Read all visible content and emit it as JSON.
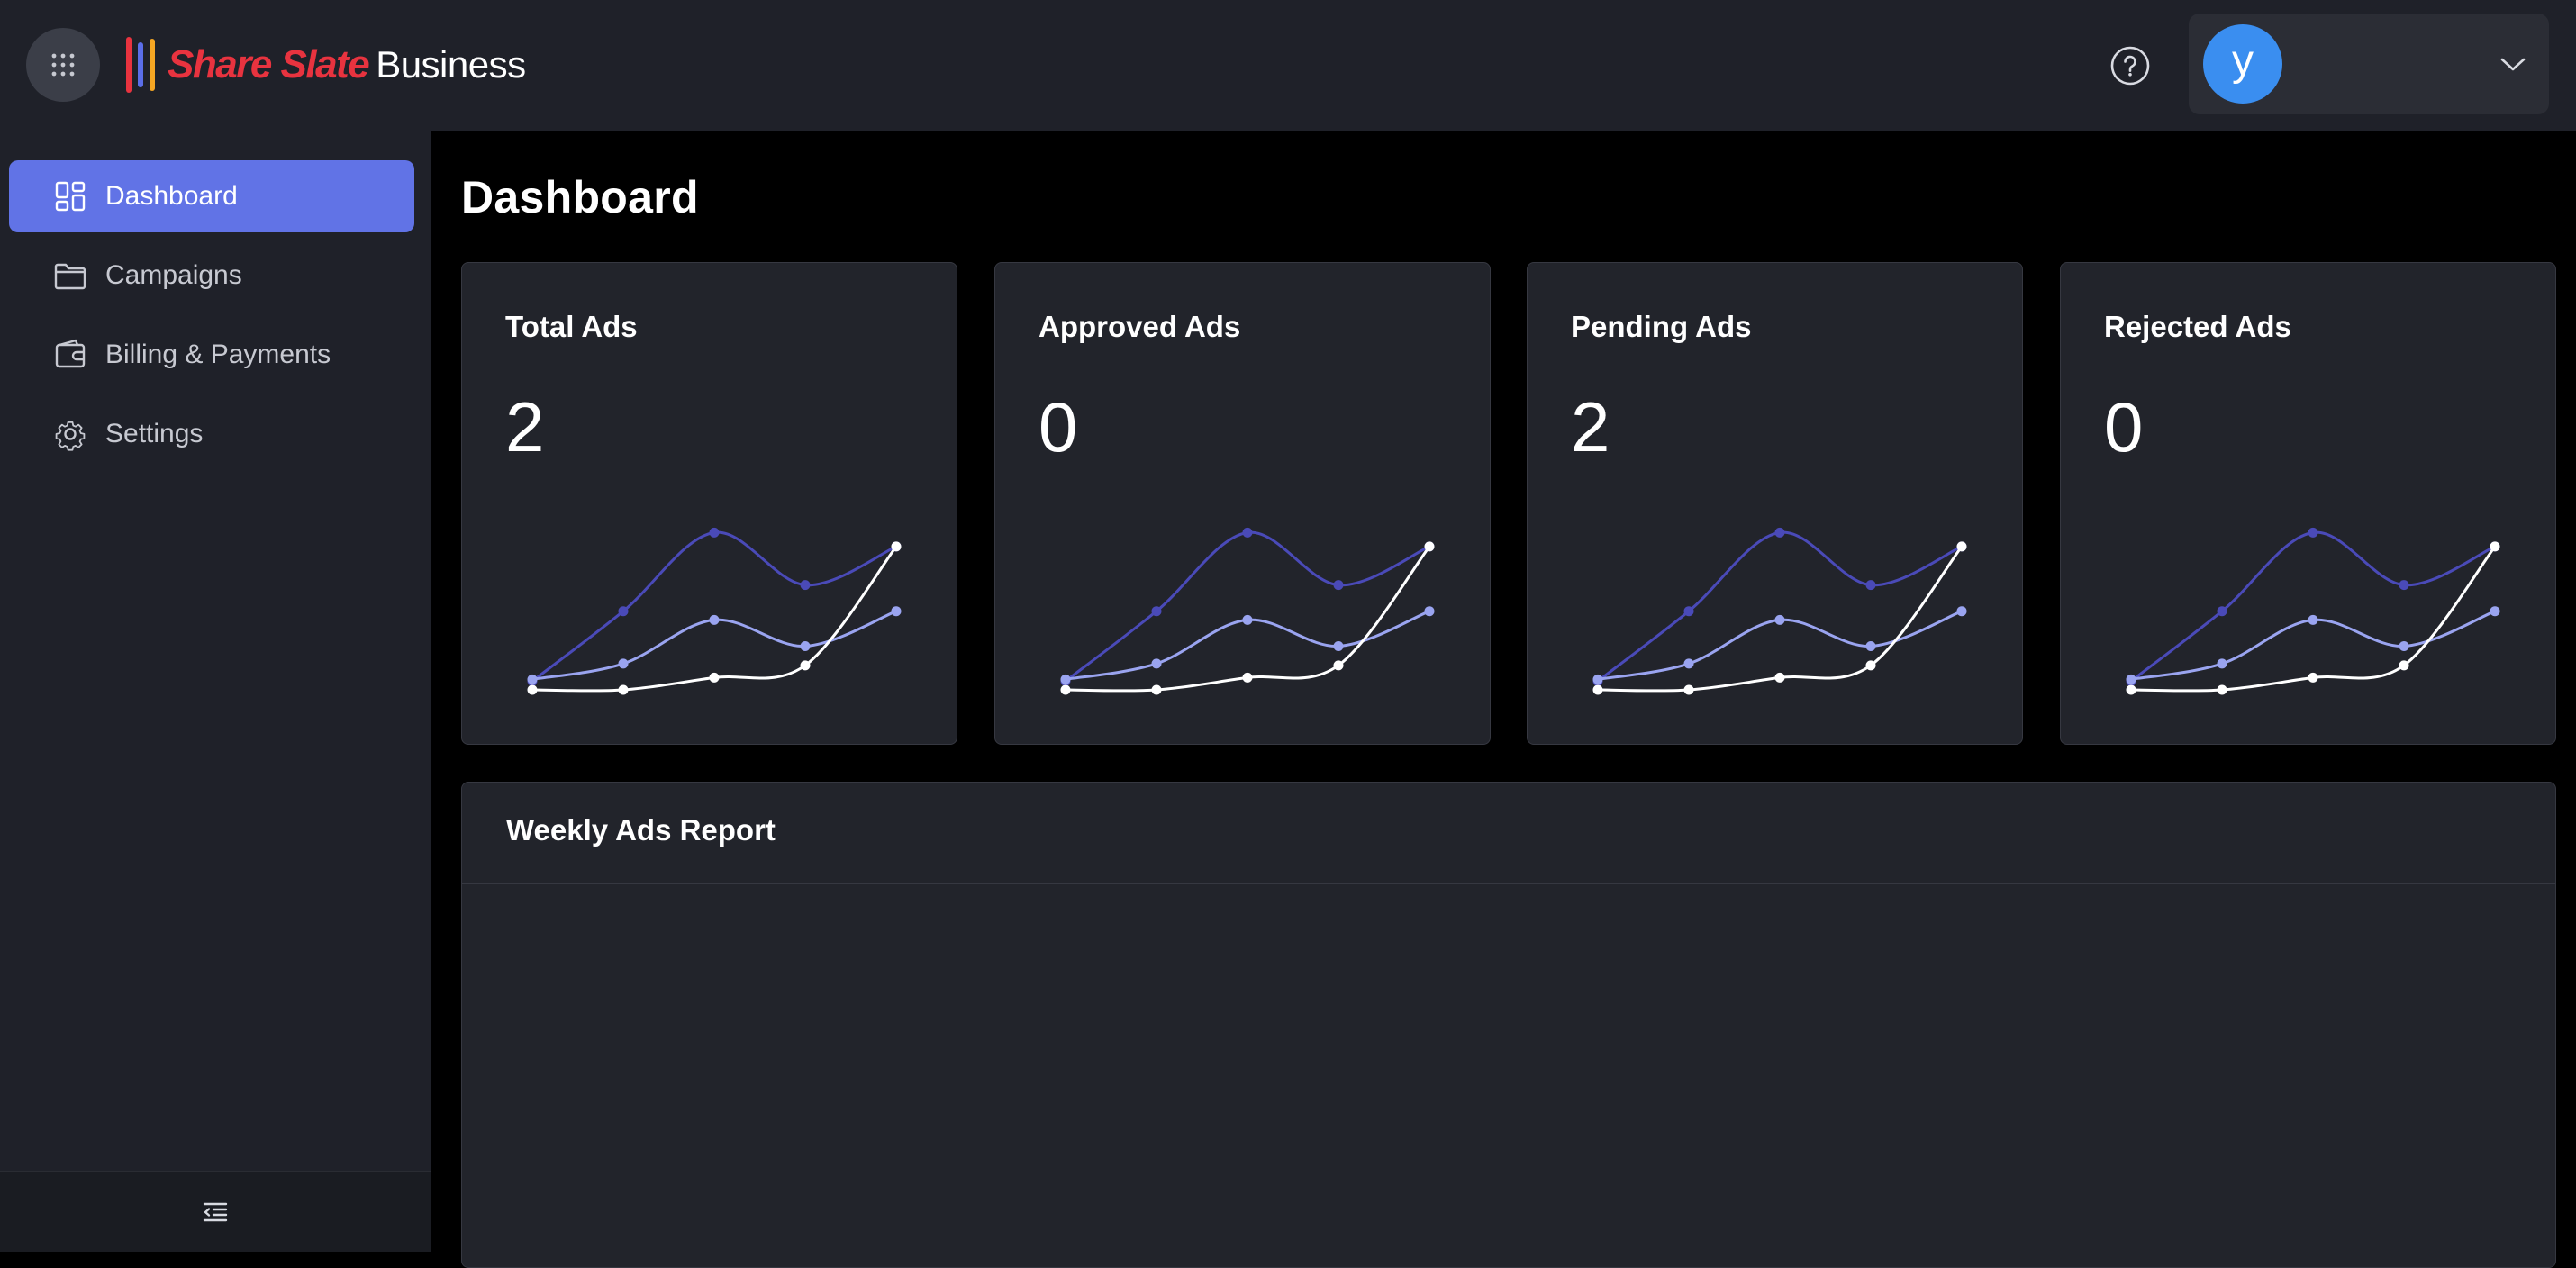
{
  "brand": {
    "name": "Share Slate",
    "suffix": "Business",
    "name_color": "#e8333f",
    "bar_colors": [
      "#e8333f",
      "#5b6ee8",
      "#f5a623"
    ]
  },
  "header": {
    "apps_icon": "grid-dots-icon",
    "help_icon": "question-circle-icon",
    "user": {
      "avatar_letter": "y",
      "avatar_color": "#3a8ef0",
      "menu_icon": "chevron-down-icon"
    }
  },
  "sidebar": {
    "items": [
      {
        "label": "Dashboard",
        "icon": "dashboard-icon",
        "active": true
      },
      {
        "label": "Campaigns",
        "icon": "folder-icon",
        "active": false
      },
      {
        "label": "Billing & Payments",
        "icon": "wallet-icon",
        "active": false
      },
      {
        "label": "Settings",
        "icon": "gear-icon",
        "active": false
      }
    ],
    "collapse_icon": "collapse-menu-icon"
  },
  "main": {
    "title": "Dashboard",
    "stats": [
      {
        "title": "Total Ads",
        "value": "2"
      },
      {
        "title": "Approved Ads",
        "value": "0"
      },
      {
        "title": "Pending Ads",
        "value": "2"
      },
      {
        "title": "Rejected Ads",
        "value": "0"
      }
    ],
    "report": {
      "title": "Weekly Ads Report"
    }
  },
  "colors": {
    "accent": "#6173e6",
    "card_bg": "#22242b",
    "spark_series": [
      "#4a4ab8",
      "#9aa4f0",
      "#ffffff"
    ]
  },
  "chart_data": {
    "type": "line",
    "x": [
      1,
      2,
      3,
      4,
      5
    ],
    "series": [
      {
        "values": [
          0.05,
          0.45,
          0.9,
          0.6,
          0.82
        ]
      },
      {
        "values": [
          0.06,
          0.15,
          0.4,
          0.25,
          0.45
        ]
      },
      {
        "values": [
          0.0,
          0.0,
          0.07,
          0.14,
          0.82
        ]
      }
    ],
    "ylim": [
      0,
      1
    ],
    "grid": false
  }
}
